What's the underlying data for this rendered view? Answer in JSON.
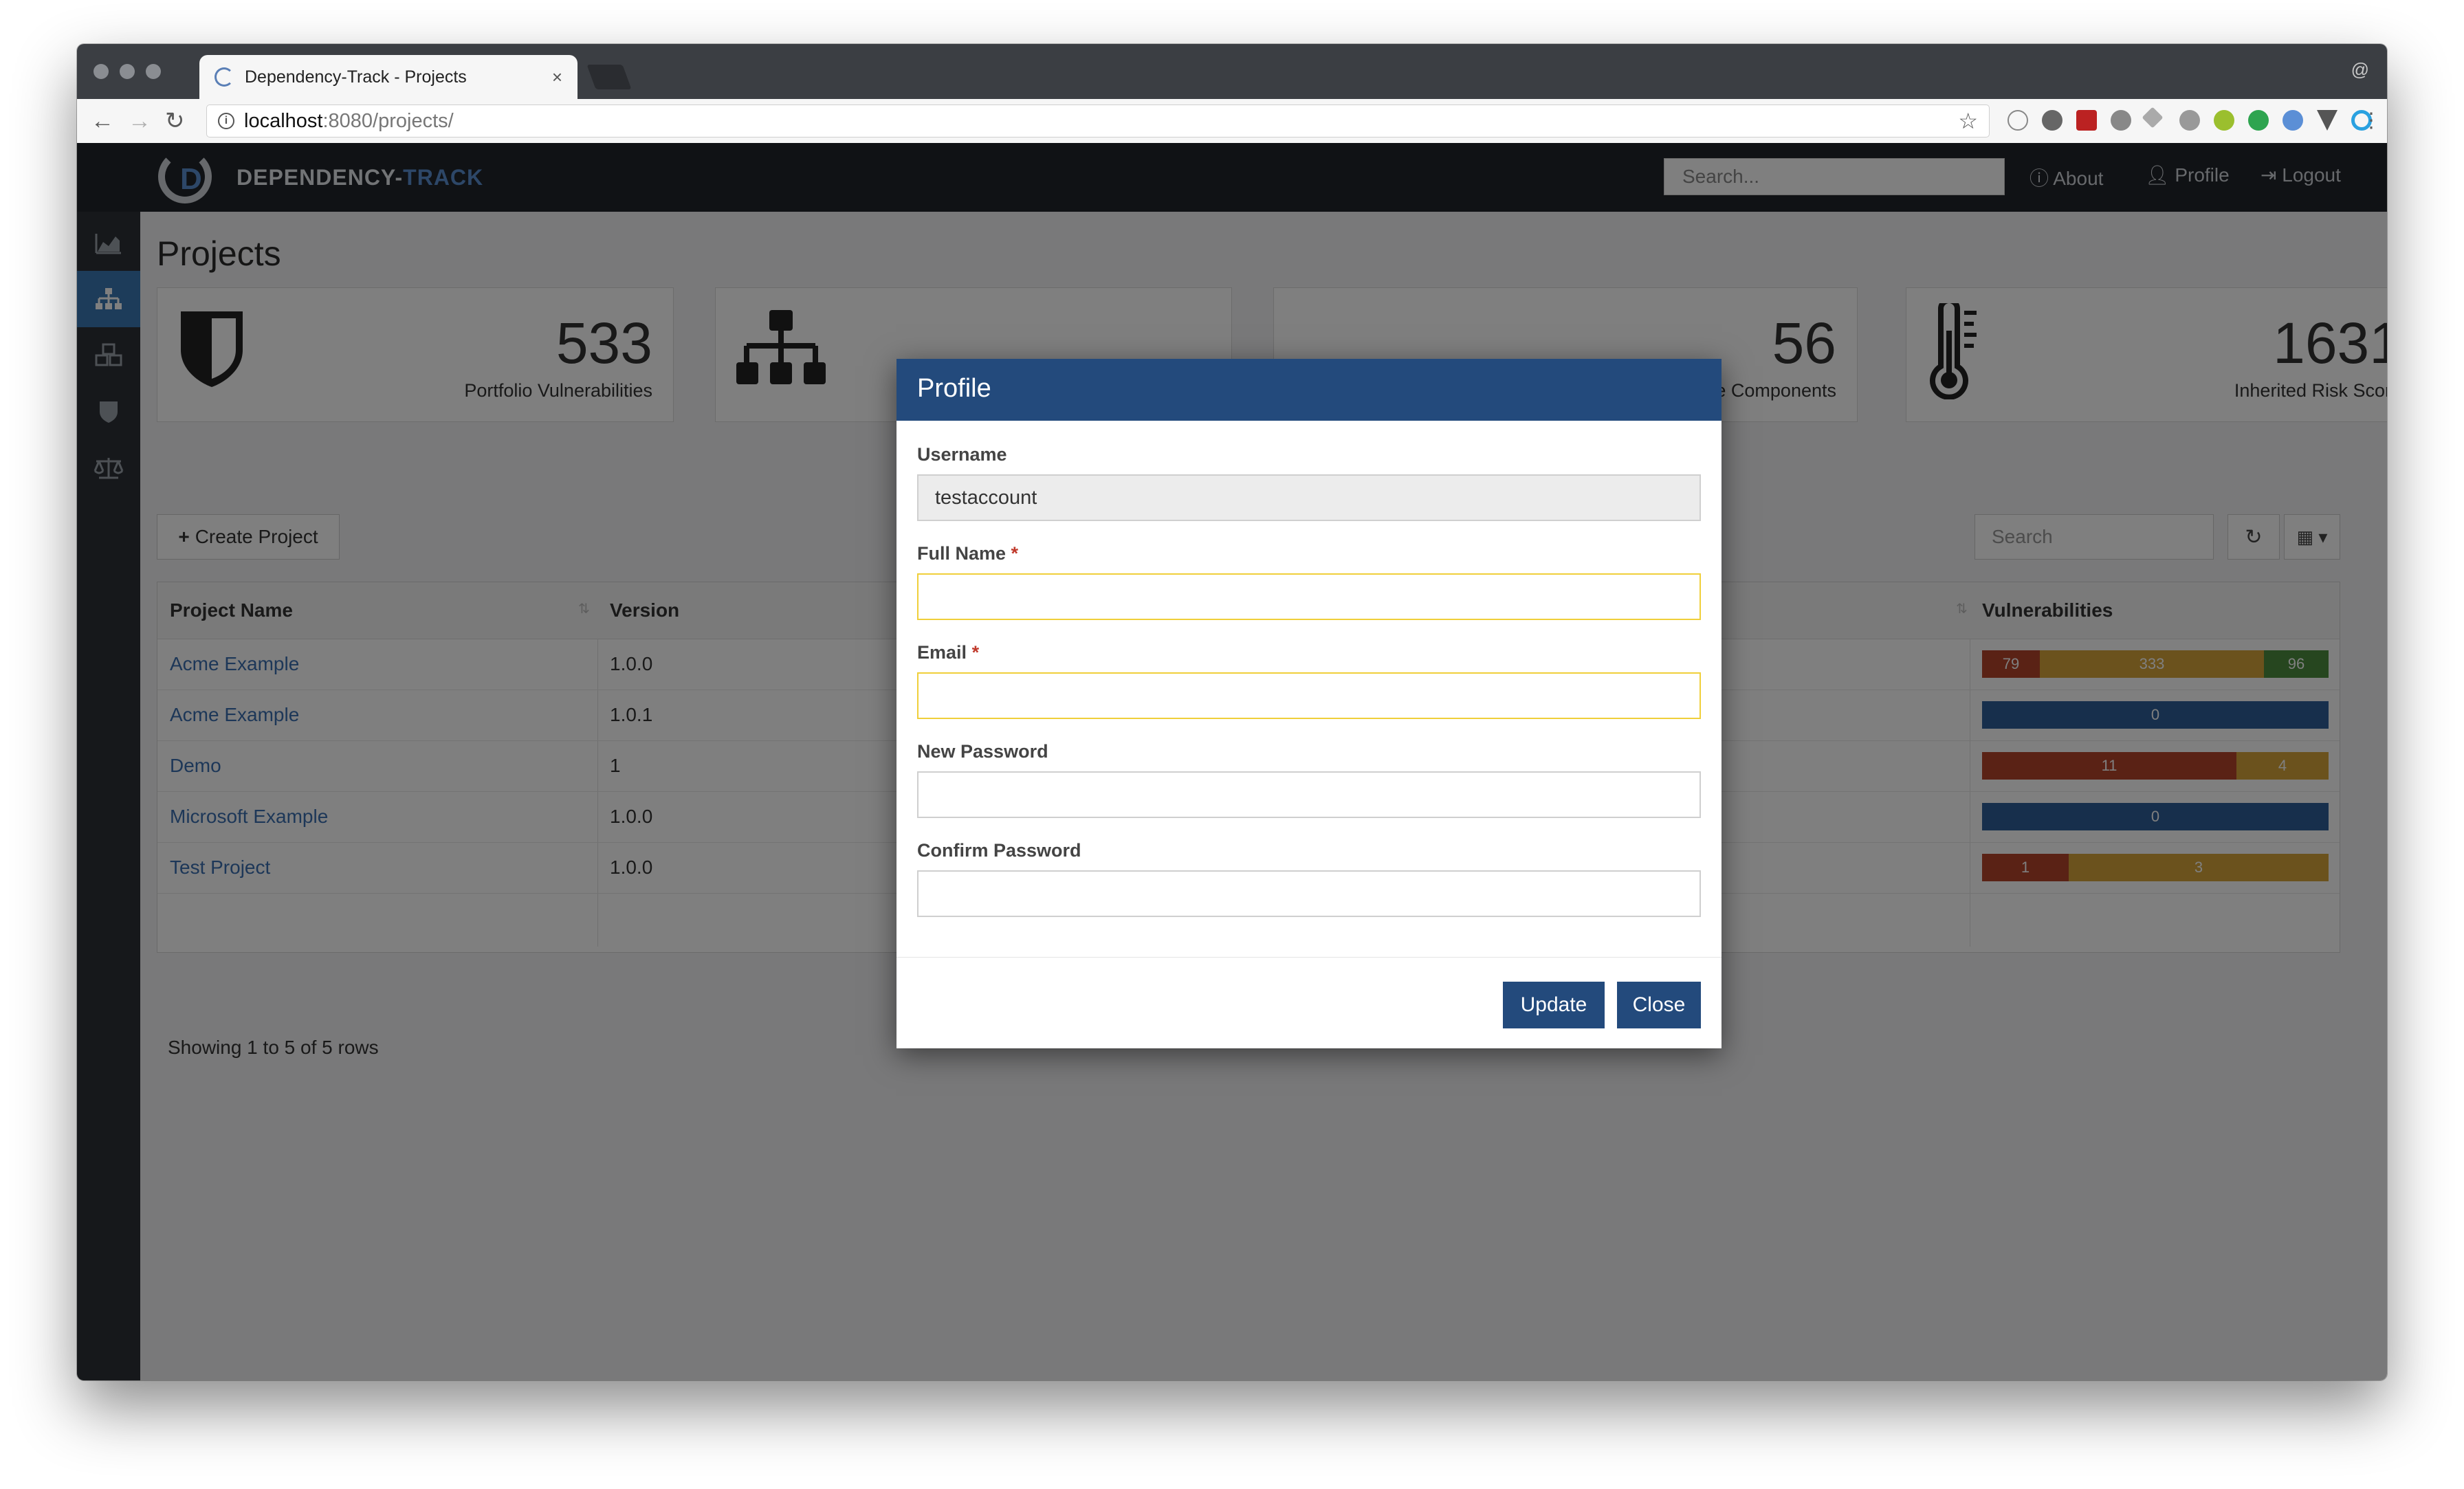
{
  "browser": {
    "tab_title": "Dependency-Track - Projects",
    "url_host": "localhost",
    "url_path": ":8080/projects/"
  },
  "app": {
    "logo_part1": "DEPENDENCY-",
    "logo_part2": "TRACK",
    "search_placeholder": "Search...",
    "nav": [
      "About",
      "Profile",
      "Logout"
    ],
    "page_title": "Projects",
    "cards": [
      {
        "value": "533",
        "label": "Portfolio Vulnerabilities"
      },
      {
        "value": "56",
        "label": "e Components"
      },
      {
        "value": "1631",
        "label": "Inherited Risk Score"
      }
    ],
    "create_label": "Create Project",
    "table_search_placeholder": "Search",
    "columns": [
      "Project Name",
      "Version",
      "Vulnerabilities"
    ],
    "rows": [
      {
        "name": "Acme Example",
        "version": "1.0.0"
      },
      {
        "name": "Acme Example",
        "version": "1.0.1"
      },
      {
        "name": "Demo",
        "version": "1"
      },
      {
        "name": "Microsoft Example",
        "version": "1.0.0"
      },
      {
        "name": "Test Project",
        "version": "1.0.0"
      }
    ],
    "vuln_values": {
      "row0": [
        "79",
        "333",
        "96"
      ],
      "row1": [
        "0"
      ],
      "row2": [
        "11",
        "4"
      ],
      "row3": [
        "0"
      ],
      "row4": [
        "1",
        "3"
      ]
    },
    "footer": "Showing 1 to 5 of 5 rows"
  },
  "modal": {
    "title": "Profile",
    "username_label": "Username",
    "username_value": "testaccount",
    "fullname_label": "Full Name",
    "email_label": "Email",
    "required_marker": "*",
    "new_password_label": "New Password",
    "confirm_password_label": "Confirm Password",
    "update_label": "Update",
    "close_label": "Close"
  },
  "colors": {
    "modal_header": "#234a7c",
    "critical": "#b5442b",
    "medium": "#d6a53a",
    "low": "#4d8c3f",
    "none": "#2f5f99"
  }
}
